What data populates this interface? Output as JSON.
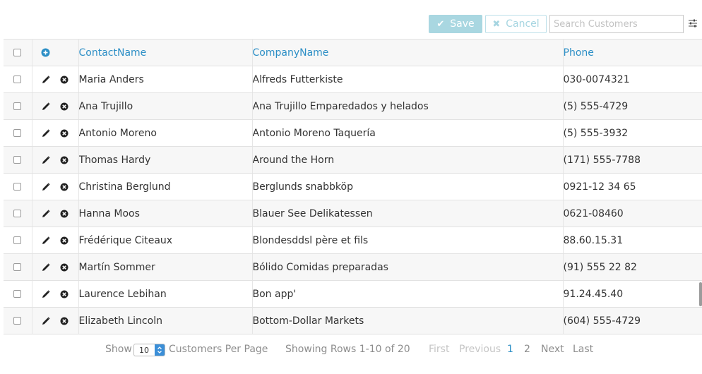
{
  "toolbar": {
    "save_label": "Save",
    "cancel_label": "Cancel",
    "search_placeholder": "Search Customers",
    "search_value": ""
  },
  "grid": {
    "columns": [
      "ContactName",
      "CompanyName",
      "Phone"
    ],
    "rows": [
      {
        "contact": "Maria Anders",
        "company": "Alfreds Futterkiste",
        "phone": "030-0074321"
      },
      {
        "contact": "Ana Trujillo",
        "company": "Ana Trujillo Emparedados y helados",
        "phone": "(5) 555-4729"
      },
      {
        "contact": "Antonio Moreno",
        "company": "Antonio Moreno Taquería",
        "phone": "(5) 555-3932"
      },
      {
        "contact": "Thomas Hardy",
        "company": "Around the Horn",
        "phone": "(171) 555-7788"
      },
      {
        "contact": "Christina Berglund",
        "company": "Berglunds snabbköp",
        "phone": "0921-12 34 65"
      },
      {
        "contact": "Hanna Moos",
        "company": "Blauer See Delikatessen",
        "phone": "0621-08460"
      },
      {
        "contact": "Frédérique Citeaux",
        "company": "Blondesddsl père et fils",
        "phone": "88.60.15.31"
      },
      {
        "contact": "Martín Sommer",
        "company": "Bólido Comidas preparadas",
        "phone": "(91) 555 22 82"
      },
      {
        "contact": "Laurence Lebihan",
        "company": "Bon app'",
        "phone": "91.24.45.40"
      },
      {
        "contact": "Elizabeth Lincoln",
        "company": "Bottom-Dollar Markets",
        "phone": "(604) 555-4729"
      }
    ]
  },
  "pager": {
    "show_label": "Show",
    "per_page_value": "10",
    "per_page_label": "Customers Per Page",
    "showing_text": "Showing Rows 1-10 of 20",
    "first": "First",
    "previous": "Previous",
    "page1": "1",
    "page2": "2",
    "next": "Next",
    "last": "Last"
  },
  "colors": {
    "accent": "#2d8fc6",
    "save_bg": "#a9d7e1",
    "cancel_text": "#a6d5e1",
    "stripe": "#f7f7f7"
  }
}
